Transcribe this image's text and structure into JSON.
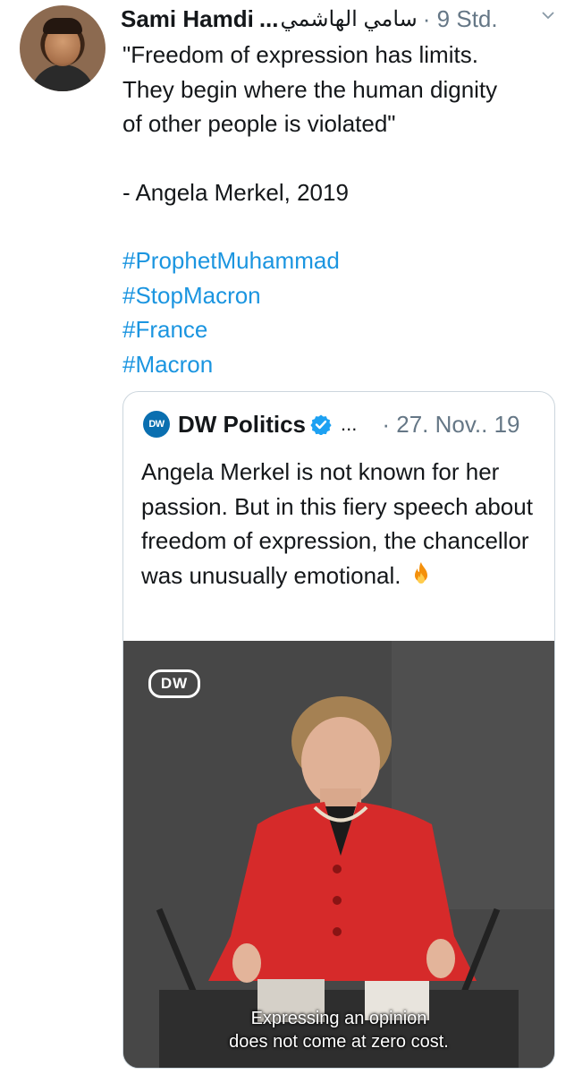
{
  "tweet": {
    "author_name": "Sami Hamdi",
    "name_truncation": "...",
    "author_name_arabic": "سامي الهاشمي",
    "time": "· 9 Std.",
    "text_lines": [
      "\"Freedom of expression has limits.",
      "They begin where the human dignity",
      "of other people is violated\""
    ],
    "attribution": "- Angela Merkel, 2019",
    "hashtags": [
      "#ProphetMuhammad",
      "#StopMacron",
      "#France",
      "#Macron"
    ]
  },
  "quoted_tweet": {
    "logo_text": "DW",
    "author_name": "DW Politics",
    "name_truncation": "...",
    "date": "· 27. Nov.. 19",
    "text": "Angela Merkel is not known for her passion. But in this fiery speech about freedom of expression, the chancellor was unusually emotional.",
    "emoji": "fire-icon",
    "video": {
      "logo_text": "DW",
      "subtitle_line1": "Expressing an opinion",
      "subtitle_line2": "does not come at zero cost."
    }
  },
  "colors": {
    "text": "#14171a",
    "meta": "#657786",
    "link": "#1b95e0",
    "border": "#ccd6dd",
    "dw_blue": "#0a6fb0",
    "jacket_red": "#d62a2a"
  }
}
